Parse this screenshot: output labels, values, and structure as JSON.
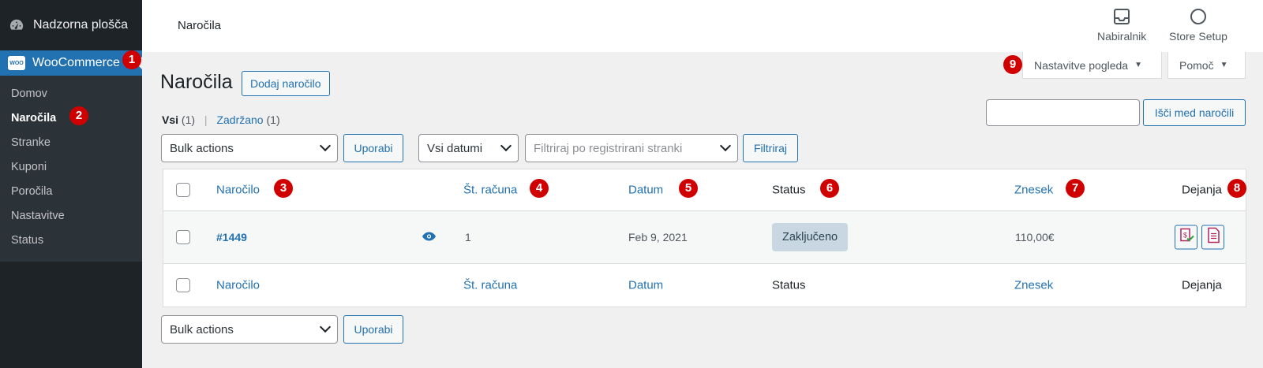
{
  "sidebar": {
    "dashboard_label": "Nadzorna plošča",
    "woo_logo_text": "WOO",
    "woocommerce_label": "WooCommerce",
    "items": [
      {
        "label": "Domov"
      },
      {
        "label": "Naročila"
      },
      {
        "label": "Stranke"
      },
      {
        "label": "Kuponi"
      },
      {
        "label": "Poročila"
      },
      {
        "label": "Nastavitve"
      },
      {
        "label": "Status"
      }
    ]
  },
  "topbar": {
    "title": "Naročila",
    "inbox_label": "Nabiralnik",
    "store_setup_label": "Store Setup"
  },
  "screen_options": {
    "label": "Nastavitve pogleda",
    "help_label": "Pomoč"
  },
  "page": {
    "title": "Naročila",
    "add_order_label": "Dodaj naročilo"
  },
  "subsubsub": {
    "all_label": "Vsi",
    "all_count": "(1)",
    "held_label": "Zadržano",
    "held_count": "(1)"
  },
  "search": {
    "value": "",
    "button_label": "Išči med naročili"
  },
  "filters": {
    "bulk_actions": "Bulk actions",
    "apply_label": "Uporabi",
    "dates": "Vsi datumi",
    "customer_placeholder": "Filtriraj po registrirani stranki",
    "filter_label": "Filtriraj"
  },
  "table": {
    "columns": {
      "order": "Naročilo",
      "invoice": "Št. računa",
      "date": "Datum",
      "status": "Status",
      "total": "Znesek",
      "actions": "Dejanja"
    },
    "rows": [
      {
        "order": "#1449",
        "invoice": "1",
        "date": "Feb 9, 2021",
        "status": "Zaključeno",
        "total": "110,00€"
      }
    ]
  },
  "bottom": {
    "bulk_actions": "Bulk actions",
    "apply_label": "Uporabi"
  },
  "annotations": [
    "1",
    "2",
    "3",
    "4",
    "5",
    "6",
    "7",
    "8",
    "9"
  ],
  "colors": {
    "accent": "#2271b1",
    "sidebar_bg": "#1d2327",
    "submenu_bg": "#2c3338",
    "annotation": "#d10000",
    "status_complete": "#c8d7e1"
  }
}
